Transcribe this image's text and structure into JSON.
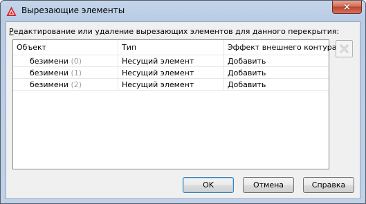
{
  "window": {
    "title": "Вырезающие элементы",
    "icon": "autocad-icon",
    "close_label": "×"
  },
  "instruction": {
    "first_letter": "Р",
    "rest": "едактирование или удаление вырезающих элементов для данного перекрытия:"
  },
  "table": {
    "columns": [
      "Объект",
      "Тип",
      "Эффект внешнего контура"
    ],
    "rows": [
      {
        "name": "безимени",
        "index": "(0)",
        "type": "Несущий элемент",
        "effect": "Добавить"
      },
      {
        "name": "безимени",
        "index": "(1)",
        "type": "Несущий элемент",
        "effect": "Добавить"
      },
      {
        "name": "безимени",
        "index": "(2)",
        "type": "Несущий элемент",
        "effect": "Добавить"
      }
    ]
  },
  "delete_button": {
    "icon": "delete-x-icon",
    "enabled": false
  },
  "buttons": {
    "ok": "OK",
    "cancel": "Отмена",
    "help": "Справка"
  }
}
